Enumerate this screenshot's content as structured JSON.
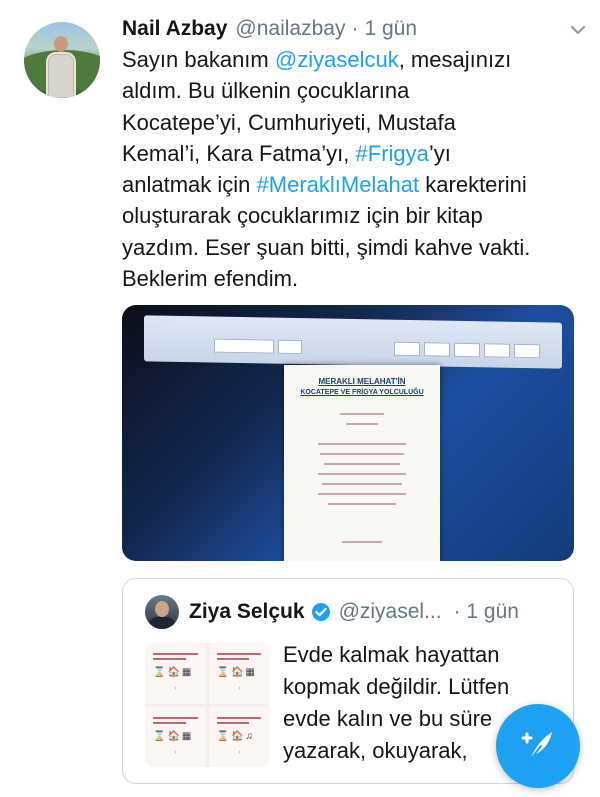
{
  "tweet": {
    "display_name": "Nail Azbay",
    "handle": "@nailazbay",
    "separator": "·",
    "time": "1 gün",
    "lines": [
      [
        "Sayın bakanım ",
        "@ziyaselcuk",
        ", mesajınızı"
      ],
      [
        "aldım. Bu ülkenin çocuklarına"
      ],
      [
        "Kocatepe’yi, Cumhuriyeti, Mustafa"
      ],
      [
        "Kemal’i, Kara Fatma’yı, ",
        "#Frigya",
        "’yı"
      ],
      [
        "anlatmak için ",
        "#MeraklıMelahat",
        " karekterini"
      ],
      [
        "oluşturarak çocuklarımız için bir kitap"
      ],
      [
        "yazdım. Eser şuan bitti, şimdi kahve vakti."
      ],
      [
        "Beklerim efendim."
      ]
    ],
    "mention": "@ziyaselcuk",
    "hashtag_1": "#Frigya",
    "hashtag_2": "#MeraklıMelahat"
  },
  "photo": {
    "doc_title_1": "MERAKLI MELAHAT'İN",
    "doc_title_2": "KOCATEPE VE FRİGYA YOLCULUĞU"
  },
  "quoted_tweet": {
    "display_name": "Ziya Selçuk",
    "handle": "@ziyasel...",
    "separator": "·",
    "time": "1 gün",
    "verified": true,
    "lines": [
      "Evde kalmak hayattan",
      "kopmak değildir. Lütfen",
      "evde kalın ve bu süre",
      "yazarak, okuyarak,"
    ]
  },
  "colors": {
    "link": "#1da1f2",
    "text": "#14171a",
    "muted": "#657786",
    "border": "#ccd6dd",
    "fab": "#1da1f2"
  },
  "icons": {
    "menu": "chevron-down-icon",
    "verified": "verified-badge-icon",
    "compose": "compose-tweet-icon"
  }
}
